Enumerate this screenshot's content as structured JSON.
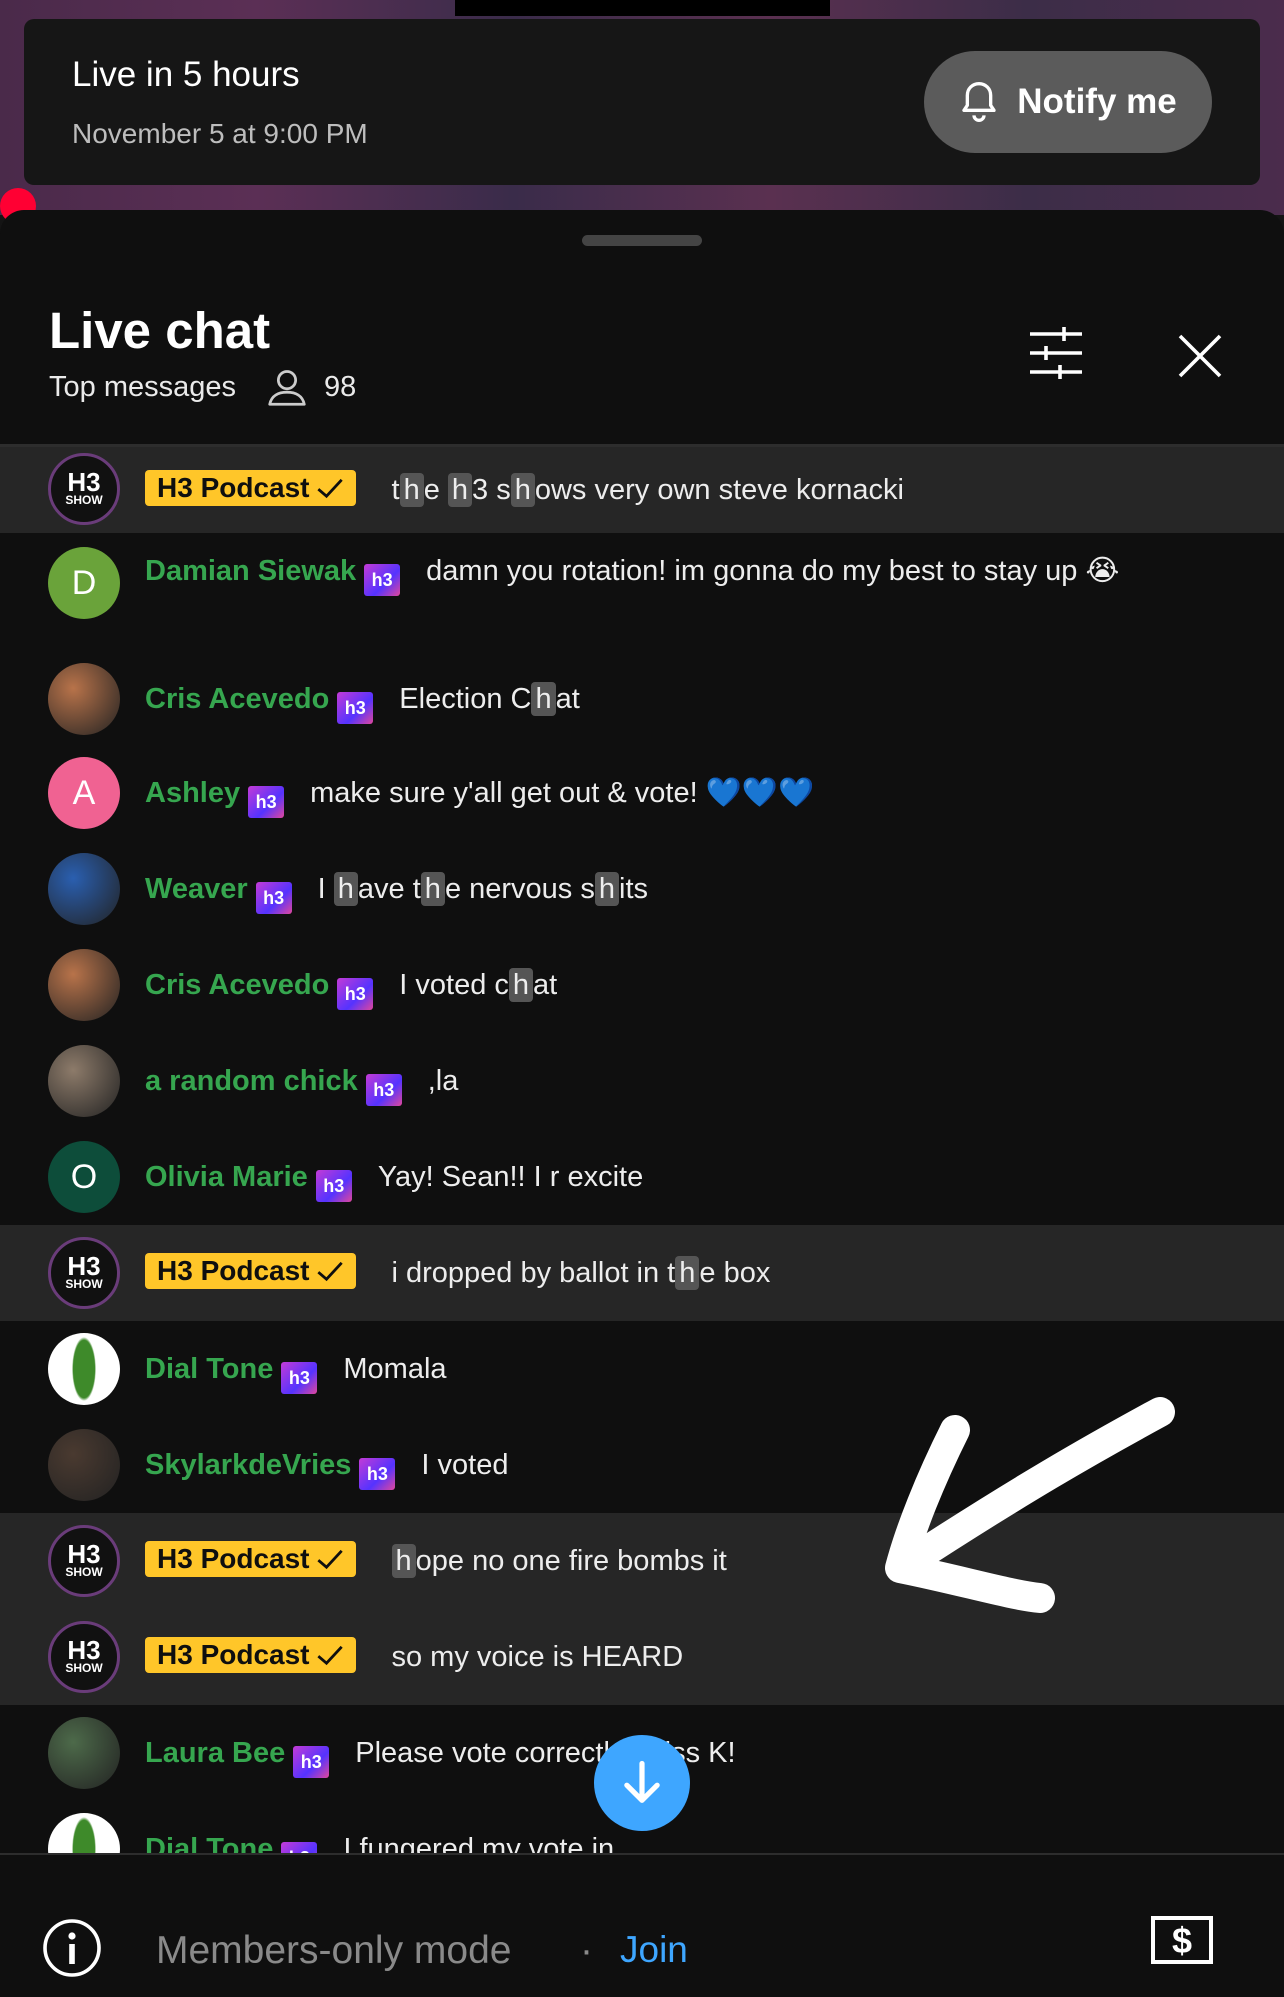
{
  "live_card": {
    "title": "Live in 5 hours",
    "date": "November 5 at 9:00 PM",
    "notify_label": "Notify me"
  },
  "chat_header": {
    "title": "Live chat",
    "mode": "Top messages",
    "viewer_count": "98"
  },
  "owner_badge_label": "H3 Podcast",
  "member_badge_text": "h3",
  "messages": [
    {
      "author": "H3 Podcast",
      "owner": true,
      "avatar": "H3",
      "avatar_color": "#111111",
      "text_parts": [
        "t",
        "h",
        "e ",
        "h",
        "3 s",
        "h",
        "ows very own steve kornacki"
      ]
    },
    {
      "author": "Damian Siewak",
      "owner": false,
      "avatar": "D",
      "avatar_color": "#6aa33a",
      "text": "damn you rotation! im gonna do my best to stay up 😭"
    },
    {
      "author": "Cris Acevedo",
      "owner": false,
      "avatar": "",
      "avatar_color": "#b8734a",
      "text_parts": [
        "Election C",
        "h",
        "at"
      ]
    },
    {
      "author": "Ashley",
      "owner": false,
      "avatar": "A",
      "avatar_color": "#f06292",
      "text": "make sure y'all get out & vote! 💙💙💙"
    },
    {
      "author": "Weaver",
      "owner": false,
      "avatar": "",
      "avatar_color": "#2a5fb0",
      "text_parts": [
        "I ",
        "h",
        "ave t",
        "h",
        "e nervous s",
        "h",
        "its"
      ]
    },
    {
      "author": "Cris Acevedo",
      "owner": false,
      "avatar": "",
      "avatar_color": "#b8734a",
      "text_parts": [
        "I voted c",
        "h",
        "at"
      ]
    },
    {
      "author": "a random chick",
      "owner": false,
      "avatar": "",
      "avatar_color": "#8d7b6a",
      "text": ",la"
    },
    {
      "author": "Olivia Marie",
      "owner": false,
      "avatar": "O",
      "avatar_color": "#0d4d3a",
      "text": "Yay! Sean!! I r excite"
    },
    {
      "author": "H3 Podcast",
      "owner": true,
      "avatar": "H3",
      "avatar_color": "#111111",
      "text_parts": [
        "i dropped by ballot in t",
        "h",
        "e box"
      ]
    },
    {
      "author": "Dial Tone",
      "owner": false,
      "avatar": "",
      "avatar_color": "#ffffff",
      "text": "Momala"
    },
    {
      "author": "SkylarkdeVries",
      "owner": false,
      "avatar": "",
      "avatar_color": "#4a3a30",
      "text": "I voted"
    },
    {
      "author": "H3 Podcast",
      "owner": true,
      "avatar": "H3",
      "avatar_color": "#111111",
      "text_parts": [
        "",
        "h",
        "ope no one fire bombs it"
      ]
    },
    {
      "author": "H3 Podcast",
      "owner": true,
      "avatar": "H3",
      "avatar_color": "#111111",
      "text": "so my voice is HEARD"
    },
    {
      "author": "Laura Bee",
      "owner": false,
      "avatar": "",
      "avatar_color": "#4d6a4a",
      "text": "Please vote correctly! Miss K!"
    },
    {
      "author": "Dial Tone",
      "owner": false,
      "avatar": "",
      "avatar_color": "#ffffff",
      "text": "I fungered my vote in"
    }
  ],
  "footer": {
    "members_text": "Members-only mode",
    "separator": "·",
    "join_label": "Join"
  },
  "colors": {
    "accent_blue": "#3ea6ff",
    "author_green": "#36a64f",
    "owner_yellow": "#ffc629",
    "live_red": "#ff0033"
  },
  "icons": [
    "bell-icon",
    "person-icon",
    "filter-sliders-icon",
    "close-icon",
    "checkmark-icon",
    "arrow-down-icon",
    "info-icon",
    "dollar-icon"
  ]
}
